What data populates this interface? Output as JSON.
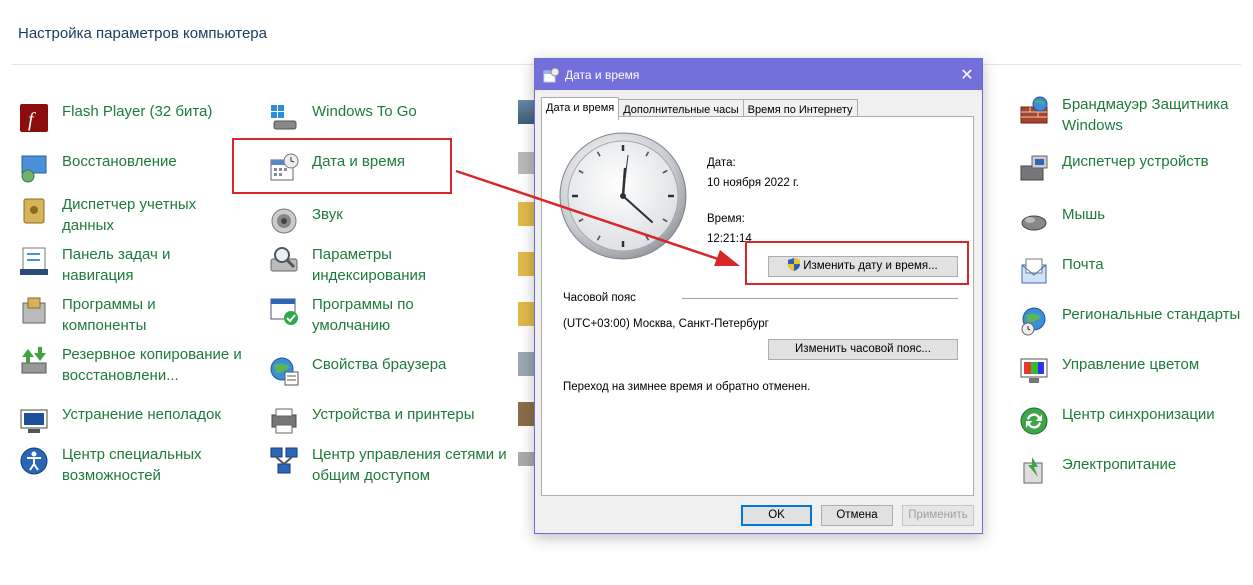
{
  "page": {
    "title": "Настройка параметров компьютера"
  },
  "col1": [
    {
      "label": "Flash Player (32 бита)",
      "icon": "flash-player-icon"
    },
    {
      "label": "Восстановление",
      "icon": "recovery-icon"
    },
    {
      "label": "Диспетчер учетных данных",
      "icon": "credential-manager-icon"
    },
    {
      "label": "Панель задач и навигация",
      "icon": "taskbar-icon"
    },
    {
      "label": "Программы и компоненты",
      "icon": "programs-features-icon"
    },
    {
      "label": "Резервное копирование и восстановлени...",
      "icon": "backup-restore-icon"
    },
    {
      "label": "Устранение неполадок",
      "icon": "troubleshooting-icon"
    },
    {
      "label": "Центр специальных возможностей",
      "icon": "ease-of-access-icon"
    }
  ],
  "col2": [
    {
      "label": "Windows To Go",
      "icon": "windows-to-go-icon"
    },
    {
      "label": "Дата и время",
      "icon": "date-time-icon"
    },
    {
      "label": "Звук",
      "icon": "sound-icon"
    },
    {
      "label": "Параметры индексирования",
      "icon": "indexing-options-icon"
    },
    {
      "label": "Программы по умолчанию",
      "icon": "default-programs-icon"
    },
    {
      "label": "Свойства браузера",
      "icon": "internet-options-icon"
    },
    {
      "label": "Устройства и принтеры",
      "icon": "devices-printers-icon"
    },
    {
      "label": "Центр управления сетями и общим доступом",
      "icon": "network-center-icon"
    }
  ],
  "col4": [
    {
      "label": "Брандмауэр Защитника Windows",
      "icon": "firewall-icon"
    },
    {
      "label": "Диспетчер устройств",
      "icon": "device-manager-icon"
    },
    {
      "label": "Мышь",
      "icon": "mouse-icon"
    },
    {
      "label": "Почта",
      "icon": "mail-icon"
    },
    {
      "label": "Региональные стандарты",
      "icon": "region-icon"
    },
    {
      "label": "Управление цветом",
      "icon": "color-management-icon"
    },
    {
      "label": "Центр синхронизации",
      "icon": "sync-center-icon"
    },
    {
      "label": "Электропитание",
      "icon": "power-options-icon"
    }
  ],
  "dialog": {
    "title": "Дата и время",
    "close": "✕",
    "tabs": [
      "Дата и время",
      "Дополнительные часы",
      "Время по Интернету"
    ],
    "date_label": "Дата:",
    "date_value": "10 ноября 2022 г.",
    "time_label": "Время:",
    "time_value": "12:21:14",
    "change_datetime": "Изменить дату и время...",
    "timezone_header": "Часовой пояс",
    "timezone_value": "(UTC+03:00) Москва, Санкт-Петербург",
    "change_timezone": "Изменить часовой пояс...",
    "dst_note": "Переход на зимнее время и обратно отменен.",
    "ok": "OK",
    "cancel": "Отмена",
    "apply": "Применить"
  },
  "colors": {
    "link": "#1f7a3a",
    "title_bar": "#7370dc",
    "highlight": "#d9262b"
  }
}
